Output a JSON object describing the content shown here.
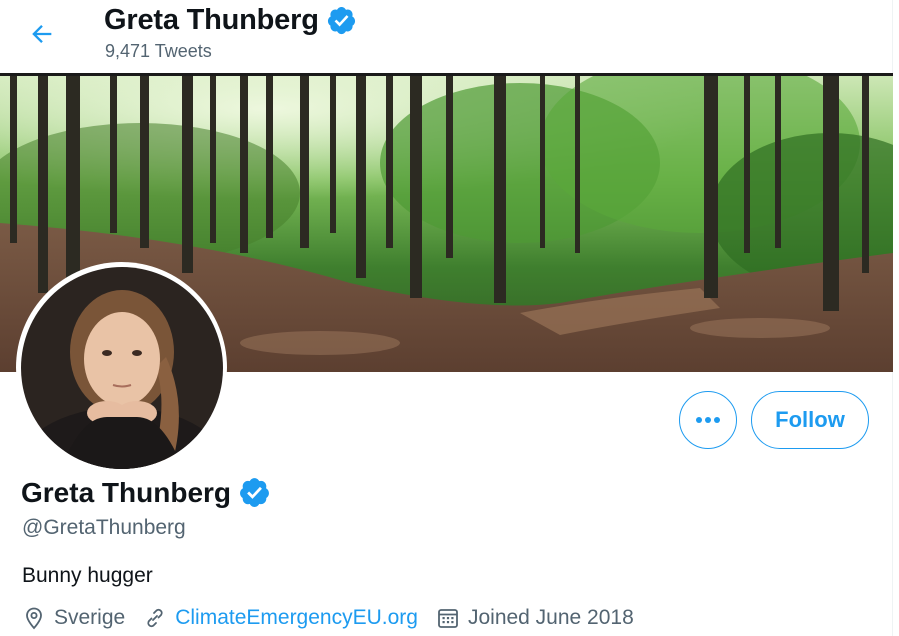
{
  "header": {
    "title": "Greta Thunberg",
    "tweet_count": "9,471 Tweets"
  },
  "profile": {
    "name": "Greta Thunberg",
    "handle": "@GretaThunberg",
    "bio": "Bunny hugger",
    "location": "Sverige",
    "website": "ClimateEmergencyEU.org",
    "joined": "Joined June 2018"
  },
  "actions": {
    "follow_label": "Follow",
    "more_label": "•••"
  },
  "icons": {
    "back": "arrow-left-icon",
    "verified": "verified-badge-icon",
    "location": "map-pin-icon",
    "link": "link-icon",
    "calendar": "calendar-icon"
  },
  "colors": {
    "accent": "#1d9bf0",
    "secondary_text": "#536471",
    "primary_text": "#0f1419"
  }
}
